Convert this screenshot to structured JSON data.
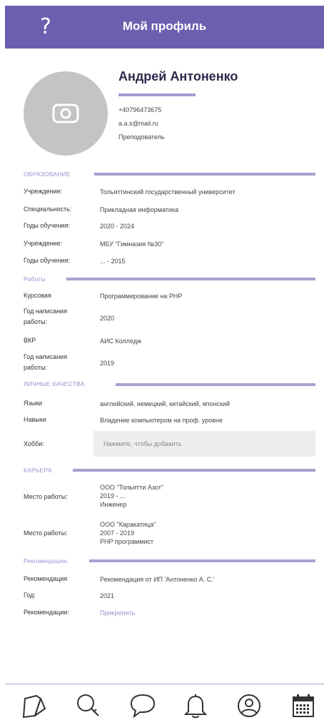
{
  "header": {
    "title": "Мой профиль",
    "help_label": "?"
  },
  "profile": {
    "name": "Андрей Антоненко",
    "phone": "+40796473675",
    "email": "a.a.s@mail.ru",
    "role": "Преподователь"
  },
  "education": {
    "title": "ОБРАЗОВАНИЕ",
    "rows": [
      {
        "label": "Учреждение:",
        "value": "Тольяттинский государственный университет"
      },
      {
        "label": "Специальность:",
        "value": "Прикладная информатика"
      },
      {
        "label": "Годы обучения:",
        "value": "2020 - 2024"
      },
      {
        "label": "Учреждение:",
        "value": "МБУ \"Гимназия №30\""
      },
      {
        "label": "Годы обучения:",
        "value": "... - 2015"
      }
    ]
  },
  "works": {
    "title": "Работы",
    "rows": [
      {
        "label": "Курсовая",
        "value": "Программирование на PHP"
      },
      {
        "label1": "Год написания",
        "label2": "работы:",
        "value": "2020"
      },
      {
        "label": "ВКР",
        "value": "АИС Колледж"
      },
      {
        "label1": "Год написания",
        "label2": "работы:",
        "value": "2019"
      }
    ]
  },
  "qualities": {
    "title": "ЛИЧНЫЕ КАЧЕСТВА",
    "rows": [
      {
        "label": "Языки",
        "value": "английский, немецкий, китайский, японский"
      },
      {
        "label": "Навыки",
        "value": "Владение компьютером на проф. уровне"
      }
    ],
    "hobby_label": "Хобби:",
    "hobby_placeholder": "Нажмите, чтобы добавить"
  },
  "career": {
    "title": "КАРЬЕРА",
    "jobs": [
      {
        "label": "Место работы:",
        "company": "ООО \"Тольятти Азот\"",
        "years": "2019 - ...",
        "position": "Инженер"
      },
      {
        "label": "Место работы:",
        "company": "ООО \"Каракатица\"",
        "years": "2007 - 2019",
        "position": "PHP программист"
      }
    ]
  },
  "recommendations": {
    "title": "Рекомендации:",
    "rows": [
      {
        "label": "Рекомендация",
        "value": "Рекомендация от ИП 'Антоненко А. С.'"
      },
      {
        "label": "Год:",
        "value": "2021"
      },
      {
        "label": "Рекомендации:",
        "value": "Прикрепить"
      }
    ]
  },
  "nav": {
    "items": [
      "notebook-icon",
      "search-icon",
      "chat-icon",
      "bell-icon",
      "profile-icon",
      "calendar-icon"
    ],
    "accent": "#6c5fb0"
  },
  "colors": {
    "header": "#6c5fb0",
    "section": "#9a92cf",
    "line": "#a7a1d1"
  }
}
